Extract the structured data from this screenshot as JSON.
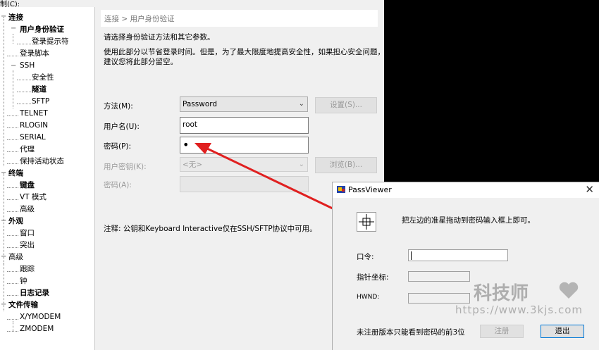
{
  "menubar": {
    "label": "制(C):"
  },
  "tree": {
    "items": [
      {
        "label": "连接",
        "bold": true,
        "toggle": "−"
      },
      {
        "label": "用户身份验证",
        "bold": true,
        "toggle": "−"
      },
      {
        "label": "登录提示符",
        "bold": false
      },
      {
        "label": "登录脚本",
        "bold": false
      },
      {
        "label": "SSH",
        "bold": false,
        "toggle": "−"
      },
      {
        "label": "安全性",
        "bold": false
      },
      {
        "label": "隧道",
        "bold": true
      },
      {
        "label": "SFTP",
        "bold": false
      },
      {
        "label": "TELNET",
        "bold": false
      },
      {
        "label": "RLOGIN",
        "bold": false
      },
      {
        "label": "SERIAL",
        "bold": false
      },
      {
        "label": "代理",
        "bold": false
      },
      {
        "label": "保持活动状态",
        "bold": false
      },
      {
        "label": "终端",
        "bold": true,
        "toggle": "−"
      },
      {
        "label": "键盘",
        "bold": true
      },
      {
        "label": "VT 模式",
        "bold": false
      },
      {
        "label": "高级",
        "bold": false
      },
      {
        "label": "外观",
        "bold": true,
        "toggle": "−"
      },
      {
        "label": "窗口",
        "bold": false
      },
      {
        "label": "突出",
        "bold": false
      },
      {
        "label": "高级",
        "bold": false,
        "toggle": "−"
      },
      {
        "label": "跟踪",
        "bold": false
      },
      {
        "label": "钟",
        "bold": false
      },
      {
        "label": "日志记录",
        "bold": true
      },
      {
        "label": "文件传输",
        "bold": true,
        "toggle": "−"
      },
      {
        "label": "X/YMODEM",
        "bold": false
      },
      {
        "label": "ZMODEM",
        "bold": false
      }
    ]
  },
  "panel": {
    "breadcrumb": "连接 > 用户身份验证",
    "desc1": "请选择身份验证方法和其它参数。",
    "desc2": "使用此部分以节省登录时间。但是，为了最大限度地提高安全性，如果担心安全问题，",
    "desc3": "建议您将此部分留空。",
    "method_label": "方法(M):",
    "method_value": "Password",
    "settings_button": "设置(S)...",
    "username_label": "用户名(U):",
    "username_value": "root",
    "password_label": "密码(P):",
    "password_value": "•",
    "userkey_label": "用户密钥(K):",
    "userkey_value": "<无>",
    "browse_button": "浏览(B)...",
    "passphrase_label": "密码(A):",
    "note": "注释: 公钥和Keyboard Interactive仅在SSH/SFTP协议中可用。"
  },
  "passviewer": {
    "title": "PassViewer",
    "instruction": "把左边的准星拖动到密码输入框上即可。",
    "password_label": "口令:",
    "coords_label": "指针坐标:",
    "hwnd_label": "HWND:",
    "footer_note": "未注册版本只能看到密码的前3位",
    "register_button": "注册",
    "exit_button": "退出"
  },
  "watermark": {
    "name": "科技师",
    "url": "https://www.3kjs.com"
  },
  "colors": {
    "arrow": "#e02020",
    "terminal": "#000000",
    "pv_icon_blue": "#2244aa",
    "pv_icon_yellow": "#f0c000"
  }
}
